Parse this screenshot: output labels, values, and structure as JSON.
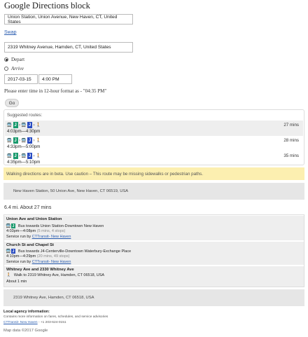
{
  "title": "Google Directions block",
  "origin_value": "Union Station, Union Avenue, New Haven, CT, United States",
  "swap_label": "Swap",
  "destination_value": "2319 Whitney Avenue, Hamden, CT, United States",
  "depart_label": "Depart",
  "arrive_label": "Arrive",
  "date_value": "2017-03-15",
  "time_value": "4:00 PM",
  "time_hint": "Please enter time in 12-hour format as - \"04:35 PM\"",
  "go_label": "Go",
  "suggested_label": "Suggested routes:",
  "routes": [
    {
      "times": "4:03pm—4:30pm",
      "duration": "27 mins",
      "badge1": "J",
      "badge2": "J"
    },
    {
      "times": "4:33pm—5:00pm",
      "duration": "28 mins",
      "badge1": "J",
      "badge2": "J"
    },
    {
      "times": "4:35pm—5:10pm",
      "duration": "35 mins",
      "badge1": "J",
      "badge2": "J"
    }
  ],
  "icons": {
    "bus": "bus-icon",
    "walk": "walk-icon",
    "arrow": "chevron-right-icon"
  },
  "colors": {
    "badge_green": "#1a9a6e",
    "badge_blue": "#2a4cc2",
    "warning_bg": "#fcefb0",
    "link": "#2a5db0"
  },
  "warning": "Walking directions are in beta. Use caution – This route may be missing sidewalks or pedestrian paths.",
  "origin_address": "New Haven Station, 50 Union Ave, New Haven, CT 06519, USA",
  "summary": "6.4 mi. About 27 mins",
  "steps": [
    {
      "title": "Union Ave and Union Station",
      "badge": "J",
      "detail": "Bus towards Union Station-Downtown New Haven",
      "time": "4:03pm—4:08pm",
      "extra": "(5 mins, 4 stops)",
      "service_prefix": "Service run by",
      "service_link": "CTTransit- New Haven"
    },
    {
      "title": "Church St and Chapel St",
      "badge": "J",
      "detail": "Bus towards J4-Centerville-Downtown Waterbury-Exchange Place",
      "time": "4:10pm—4:29pm",
      "extra": "(20 mins, 49 stops)",
      "service_prefix": "Service run by",
      "service_link": "CTTransit- New Haven"
    },
    {
      "title": "Whitney Ave and 2330 Whitney Ave",
      "detail": "Walk to 2319 Whitney Ave, Hamden, CT 06518, USA",
      "time": "About 1 min"
    }
  ],
  "destination_address": "2319 Whitney Ave, Hamden, CT 06518, USA",
  "footer": {
    "title": "Local agency information:",
    "line1": "Contains more information on fares, schedules, and service advisories",
    "agency_link": "CTTransit- New Haven",
    "phone": " - +1 203-624-0151",
    "mapdata": "Map data ©2017 Google"
  }
}
